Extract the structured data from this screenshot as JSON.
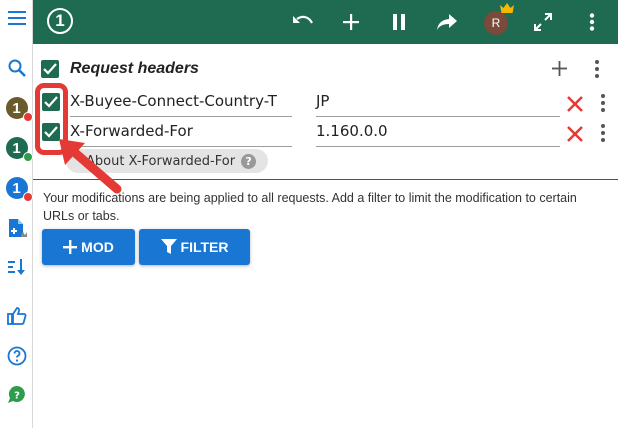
{
  "toolbar": {
    "logo_number": "1",
    "avatar_initial": "R"
  },
  "sidebar": {
    "profiles": [
      {
        "number": "1",
        "color": "#6b5a2a",
        "dot_color": "#e53935"
      },
      {
        "number": "1",
        "color": "#1e6b52",
        "dot_color": "#2e9d4a"
      },
      {
        "number": "1",
        "color": "#1976d2",
        "dot_color": "#e53935"
      }
    ]
  },
  "section": {
    "title": "Request headers",
    "rows": [
      {
        "name": "X-Buyee-Connect-Country-T",
        "value": "JP",
        "checked": true
      },
      {
        "name": "X-Forwarded-For",
        "value": "1.160.0.0",
        "checked": true
      }
    ],
    "about_chip": "About X-Forwarded-For",
    "help_glyph": "?"
  },
  "info_text": "Your modifications are being applied to all requests. Add a filter to limit the modification to certain URLs or tabs.",
  "buttons": {
    "mod": "MOD",
    "filter": "FILTER"
  },
  "colors": {
    "primary": "#1e6b52",
    "accent": "#1976d2",
    "delete": "#e53935",
    "annotation": "#e53935"
  }
}
